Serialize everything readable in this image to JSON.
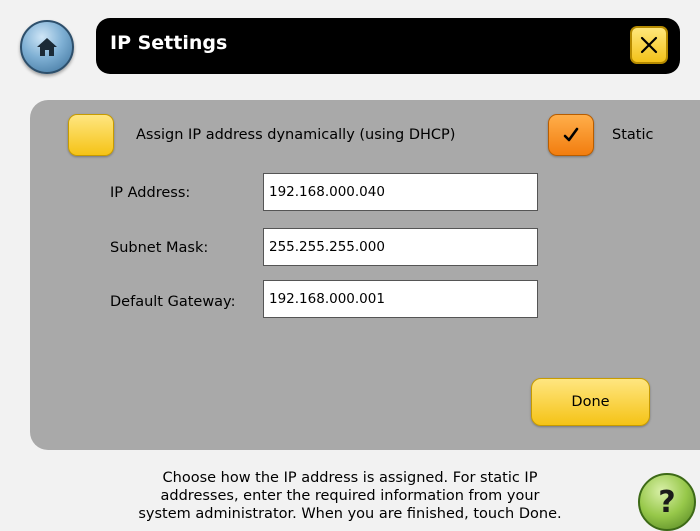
{
  "header": {
    "title": "IP Settings",
    "home_icon": "home-icon",
    "close_icon": "close-icon"
  },
  "options": {
    "dhcp_label": "Assign IP address dynamically (using DHCP)",
    "static_label": "Static",
    "selected": "Static"
  },
  "fields": {
    "ip_address": {
      "label": "IP Address:",
      "value": "192.168.000.040"
    },
    "subnet_mask": {
      "label": "Subnet Mask:",
      "value": "255.255.255.000"
    },
    "default_gateway": {
      "label": "Default Gateway:",
      "value": "192.168.000.001"
    }
  },
  "done_label": "Done",
  "help": {
    "line1": "Choose how the IP address is assigned. For static IP",
    "line2": "addresses, enter the required information from your",
    "line3": "system administrator. When you are finished, touch Done.",
    "button_label": "?"
  },
  "colors": {
    "title_bar": "#000000",
    "panel": "#a9a9a9",
    "yellow_button": "#f5c316",
    "selected_button": "#f27d0f",
    "home_button": "#5d93bd",
    "help_button": "#97c84a"
  }
}
